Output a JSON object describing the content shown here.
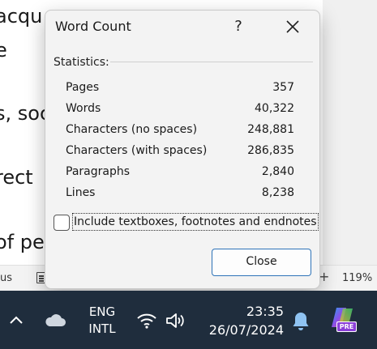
{
  "document": {
    "fragments": [
      "acqu",
      "e",
      "s, soc",
      "rect",
      "of pe"
    ]
  },
  "statusbar": {
    "left_text": "us",
    "zoom": "119%",
    "plus_icon": "+"
  },
  "dialog": {
    "title": "Word Count",
    "help_icon": "?",
    "statistics_label": "Statistics:",
    "stats": [
      {
        "label": "Pages",
        "value": "357"
      },
      {
        "label": "Words",
        "value": "40,322"
      },
      {
        "label": "Characters (no spaces)",
        "value": "248,881"
      },
      {
        "label": "Characters (with spaces)",
        "value": "286,835"
      },
      {
        "label": "Paragraphs",
        "value": "2,840"
      },
      {
        "label": "Lines",
        "value": "8,238"
      }
    ],
    "include_checkbox": {
      "label": "Include textboxes, footnotes and endnotes",
      "checked": false
    },
    "close_button": "Close",
    "accent_color": "#2e73b8"
  },
  "taskbar": {
    "language": {
      "line1": "ENG",
      "line2": "INTL"
    },
    "clock": {
      "time": "23:35",
      "date": "26/07/2024"
    },
    "copilot_badge": "PRE",
    "background_color": "#1f2d3d"
  }
}
